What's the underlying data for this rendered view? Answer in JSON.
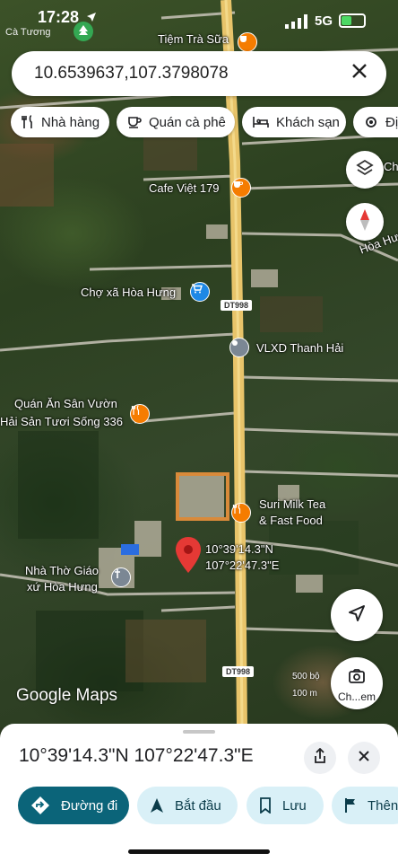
{
  "status_bar": {
    "time": "17:28",
    "back_app": "Cà Tương",
    "network": "5G",
    "battery_level": 0.45
  },
  "search": {
    "query": "10.6539637,107.3798078"
  },
  "categories": [
    {
      "label": "Nhà hàng",
      "icon": "fork-knife-icon"
    },
    {
      "label": "Quán cà phê",
      "icon": "coffee-cup-icon"
    },
    {
      "label": "Khách sạn",
      "icon": "bed-icon"
    },
    {
      "label": "Đị",
      "icon": "gear-icon"
    }
  ],
  "map": {
    "places": {
      "tra_sua": "Tiệm Trà Sữa",
      "cafe": "Cafe Việt 179",
      "cho": "Chợ xã Hòa Hưng",
      "vlxd": "VLXD Thanh Hải",
      "quan_an_1": "Quán Ăn Sân Vườn",
      "quan_an_2": "Hải Sản Tươi Sống 336",
      "suri_1": "Suri Milk Tea",
      "suri_2": "& Fast Food",
      "nha_tho_1": "Nhà Thờ Giáo",
      "nha_tho_2": "xứ Hòa Hưng",
      "pin_1": "10°39'14.3\"N",
      "pin_2": "107°22'47.3\"E",
      "hoa_hung": "Hòa Hưn",
      "ch_right": "Ch",
      "road_top": "oa"
    },
    "road_shields": [
      "DT998",
      "DT998"
    ],
    "google_logo": "Google Maps",
    "scale_ft": "500 bộ",
    "scale_m": "100 m",
    "explore_label": "Ch...em"
  },
  "sheet": {
    "title": "10°39'14.3\"N 107°22'47.3\"E",
    "actions": [
      {
        "label": "Đường đi",
        "icon": "directions-icon"
      },
      {
        "label": "Bắt đầu",
        "icon": "navigation-arrow-icon"
      },
      {
        "label": "Lưu",
        "icon": "bookmark-icon"
      },
      {
        "label": "Thên",
        "icon": "flag-icon"
      }
    ]
  },
  "colors": {
    "primary_action": "#0b6479",
    "secondary_action": "#d9f0f7",
    "pin": "#e53935",
    "poi_food": "#f57c00",
    "poi_shop": "#1e88e5",
    "road": "#e8c46a"
  }
}
